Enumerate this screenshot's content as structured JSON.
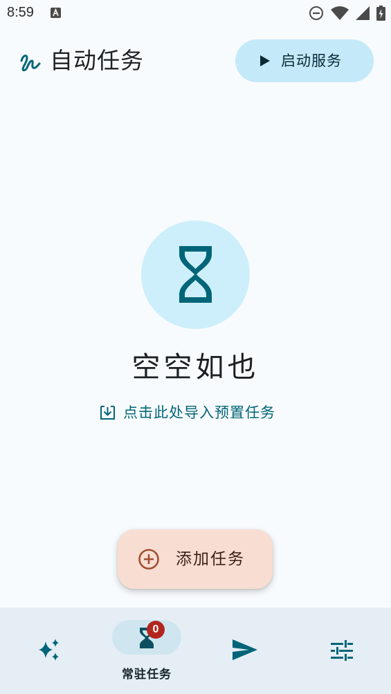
{
  "status_bar": {
    "time": "8:59",
    "icons": [
      "app-notification-icon",
      "do-not-disturb-icon",
      "wifi-icon",
      "cell-signal-icon",
      "battery-charging-icon"
    ]
  },
  "header": {
    "title": "自动任务",
    "logo_icon": "squiggle-logo-icon",
    "start_button_label": "启动服务",
    "start_button_icon": "play-icon"
  },
  "empty_state": {
    "icon": "hourglass-icon",
    "title": "空空如也",
    "import_label": "点击此处导入预置任务",
    "import_icon": "download-icon"
  },
  "fab": {
    "label": "添加任务",
    "icon": "add-circle-icon"
  },
  "bottom_nav": {
    "items": [
      {
        "id": "sparkle",
        "icon": "sparkle-icon",
        "label": "",
        "selected": false
      },
      {
        "id": "resident",
        "icon": "hourglass-icon",
        "label": "常驻任务",
        "selected": true,
        "badge": "0"
      },
      {
        "id": "send",
        "icon": "send-icon",
        "label": "",
        "selected": false
      },
      {
        "id": "settings",
        "icon": "sliders-icon",
        "label": "",
        "selected": false
      }
    ]
  },
  "colors": {
    "background": "#f8fbfd",
    "accent": "#006578",
    "start_button_bg": "#c4eaf9",
    "empty_circle_bg": "#cdeffb",
    "fab_bg": "#f8ddd3",
    "fab_icon": "#a0502e",
    "nav_bg": "#e5eef4",
    "nav_pill_bg": "#cfe6f0",
    "badge_bg": "#b3261e"
  }
}
